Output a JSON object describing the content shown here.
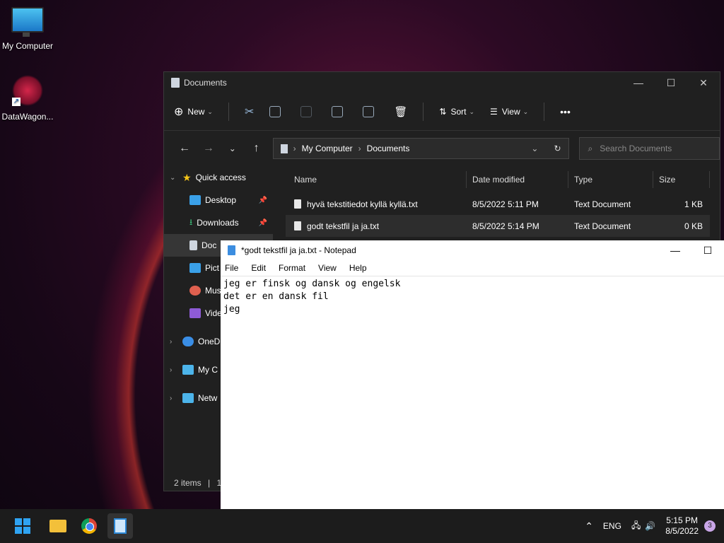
{
  "desktop": {
    "icons": [
      {
        "label": "My Computer"
      },
      {
        "label": "DataWagon..."
      }
    ]
  },
  "explorer": {
    "title": "Documents",
    "toolbar": {
      "new": "New",
      "sort": "Sort",
      "view": "View",
      "more": "•••"
    },
    "breadcrumb": [
      "My Computer",
      "Documents"
    ],
    "search_placeholder": "Search Documents",
    "nav": [
      {
        "label": "Quick access"
      },
      {
        "label": "Desktop"
      },
      {
        "label": "Downloads"
      },
      {
        "label": "Doc"
      },
      {
        "label": "Pict"
      },
      {
        "label": "Mus"
      },
      {
        "label": "Vide"
      },
      {
        "label": "OneD"
      },
      {
        "label": "My C"
      },
      {
        "label": "Netw"
      }
    ],
    "columns": {
      "name": "Name",
      "date": "Date modified",
      "type": "Type",
      "size": "Size"
    },
    "files": [
      {
        "name": "hyvä tekstitiedot kyllä kyllä.txt",
        "date": "8/5/2022 5:11 PM",
        "type": "Text Document",
        "size": "1 KB"
      },
      {
        "name": "godt tekstfil ja ja.txt",
        "date": "8/5/2022 5:14 PM",
        "type": "Text Document",
        "size": "0 KB"
      }
    ],
    "status": {
      "items": "2 items",
      "sep": "|",
      "extra": "1"
    }
  },
  "notepad": {
    "title": "*godt tekstfil ja ja.txt - Notepad",
    "menu": [
      "File",
      "Edit",
      "Format",
      "View",
      "Help"
    ],
    "lines": [
      "jeg er finsk og dansk og engelsk",
      "det er en dansk fil",
      "jeg"
    ]
  },
  "taskbar": {
    "lang": "ENG",
    "time": "5:15 PM",
    "date": "8/5/2022",
    "notifications": "3"
  }
}
